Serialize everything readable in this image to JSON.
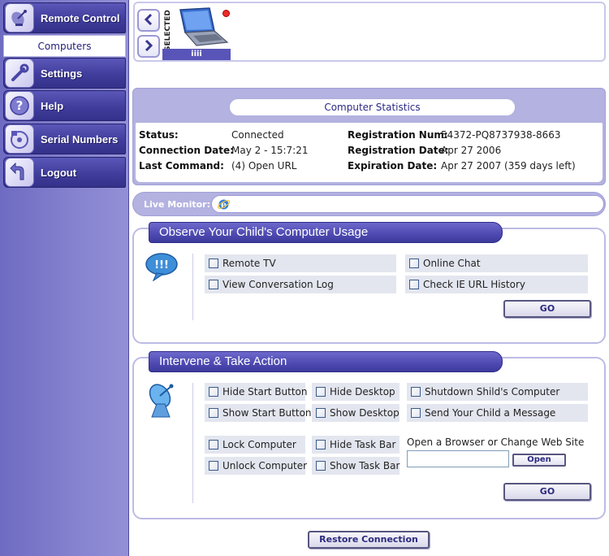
{
  "sidebar": {
    "items": [
      {
        "label": "Remote Control",
        "icon": "satellite-dish-icon"
      },
      {
        "label": "Computers"
      },
      {
        "label": "Settings",
        "icon": "wrench-icon"
      },
      {
        "label": "Help",
        "icon": "question-icon"
      },
      {
        "label": "Serial Numbers",
        "icon": "cd-icon"
      },
      {
        "label": "Logout",
        "icon": "exit-arrow-icon"
      }
    ]
  },
  "selector": {
    "selected_label": "SELECTED",
    "computer_name": "iiii",
    "status_color": "#ee2b2b"
  },
  "stats": {
    "title": "Computer Statistics",
    "status_label": "Status:",
    "status_value": "Connected",
    "connection_date_label": "Connection Date:",
    "connection_date_value": "May 2 - 15:7:21",
    "last_command_label": "Last Command:",
    "last_command_value": "(4) Open URL",
    "registration_num_label": "Registration Num:",
    "registration_num_value": "54372-PQ8737938-8663",
    "registration_date_label": "Registration Date:",
    "registration_date_value": "Apr 27 2006",
    "expiration_date_label": "Expiration Date:",
    "expiration_date_value": "Apr 27 2007 (359 days left)"
  },
  "live_monitor": {
    "label": "Live Monitor:"
  },
  "observe": {
    "title": "Observe Your Child's Computer Usage",
    "options": [
      "Remote TV",
      "Online Chat",
      "View Conversation Log",
      "Check IE URL History"
    ],
    "go_label": "GO"
  },
  "intervene": {
    "title": "Intervene & Take Action",
    "options": [
      "Hide Start Button",
      "Hide Desktop",
      "Shutdown Shild's Computer",
      "Show Start Button",
      "Show Desktop",
      "Send Your Child a Message",
      "Lock Computer",
      "Hide Task Bar",
      "Unlock Computer",
      "Show Task Bar"
    ],
    "browser_label": "Open a Browser or Change Web Site",
    "url_value": "",
    "open_label": "Open",
    "go_label": "GO"
  },
  "restore_label": "Restore Connection",
  "colors": {
    "accent": "#4d49b0",
    "panel_header_bg": "#b3b2e0",
    "sidebar_bg": "#7a77c9"
  }
}
